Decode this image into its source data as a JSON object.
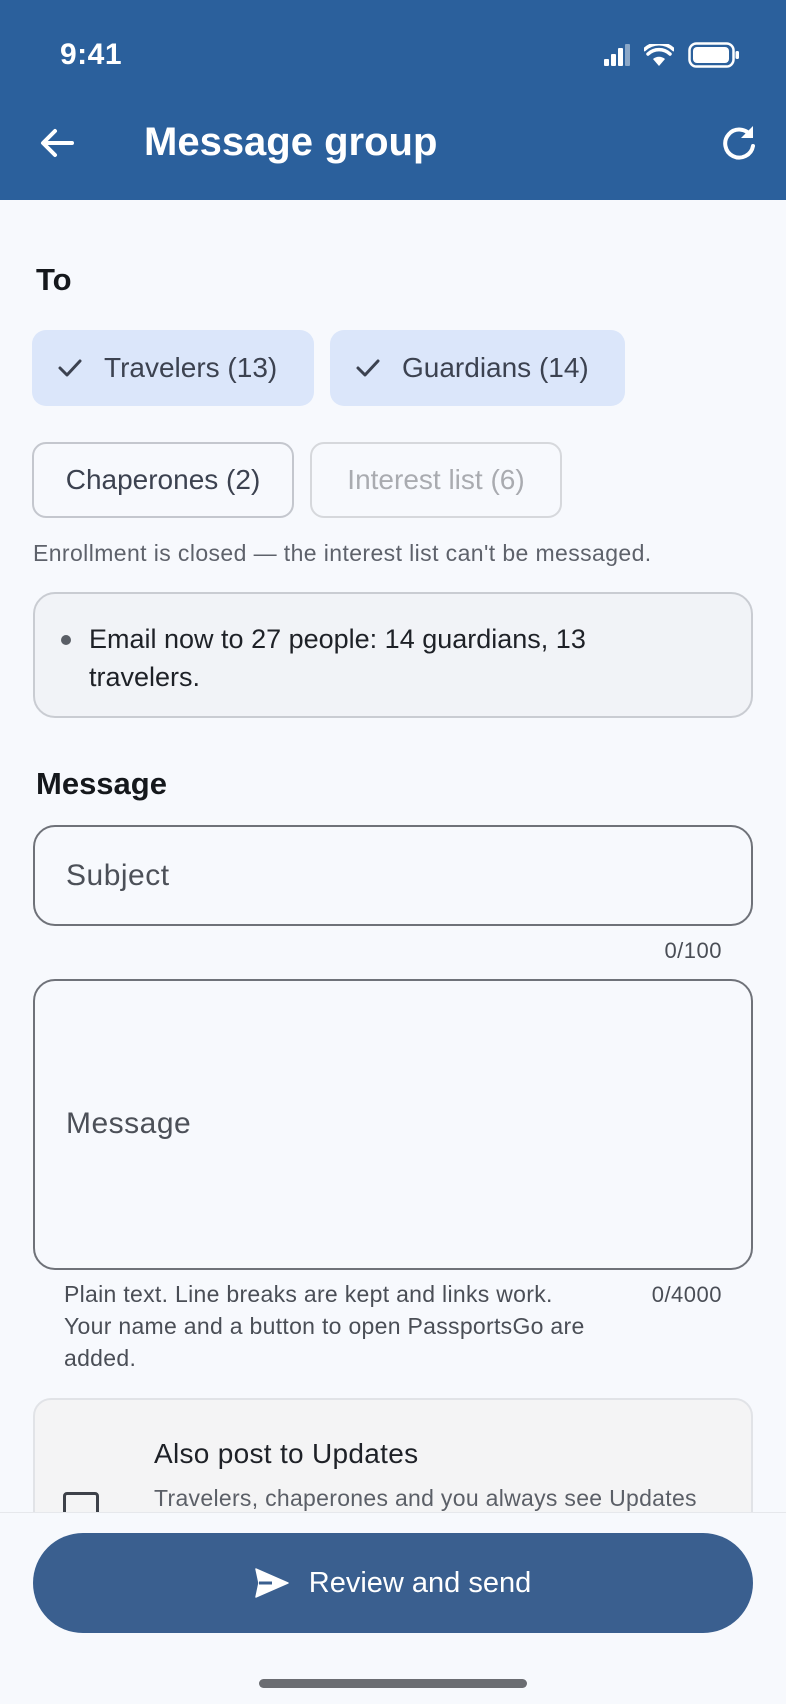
{
  "status_bar": {
    "time": "9:41"
  },
  "appbar": {
    "title": "Message group",
    "back_icon": "arrow-left-icon",
    "refresh_icon": "refresh-icon"
  },
  "recipients": {
    "label": "To",
    "chips": [
      {
        "label": "Travelers (13)",
        "selected": true,
        "enabled": true
      },
      {
        "label": "Guardians (14)",
        "selected": true,
        "enabled": true
      },
      {
        "label": "Chaperones (2)",
        "selected": false,
        "enabled": true
      },
      {
        "label": "Interest list (6)",
        "selected": false,
        "enabled": false
      }
    ],
    "helper": "Enrollment is closed — the interest list can't be messaged.",
    "summary": "Email now to 27 people: 14 guardians, 13 travelers."
  },
  "message": {
    "label": "Message",
    "subject_placeholder": "Subject",
    "subject_counter": "0/100",
    "body_placeholder": "Message",
    "body_counter": "0/4000",
    "body_help": "Plain text. Line breaks are kept and links work. Your name and a button to open PassportsGo are added."
  },
  "updates_option": {
    "title": "Also post to Updates",
    "description": "Travelers, chaperones and you always see Updates posts. Parents see this one because Guardians is",
    "checked": false
  },
  "send_button": {
    "label": "Review and send",
    "icon": "send-icon"
  },
  "colors": {
    "appbar": "#2b609c",
    "chip_selected": "#dbe6fa",
    "send_button": "#3a5f8f",
    "background": "#f7f9fd"
  }
}
